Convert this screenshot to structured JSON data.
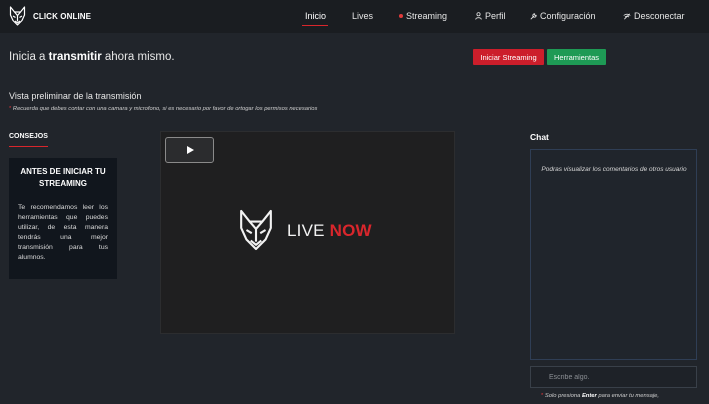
{
  "brand": {
    "name": "CLICK ONLINE",
    "logo_icon": "fox-icon"
  },
  "nav": {
    "items": [
      {
        "label": "Inicio",
        "active": true
      },
      {
        "label": "Lives",
        "active": false
      },
      {
        "label": "Streaming",
        "icon": "live-dot-icon",
        "active": false
      },
      {
        "label": "Perfil",
        "icon": "user-icon",
        "active": false
      },
      {
        "label": "Configuración",
        "icon": "wrench-icon",
        "active": false
      },
      {
        "label": "Desconectar",
        "icon": "signal-icon",
        "active": false
      }
    ]
  },
  "header": {
    "intro": "Inicia a ",
    "emphasis": "transmitir",
    "suffix": " ahora mismo.",
    "start_button": "Iniciar Streaming",
    "tools_button": "Herramientas"
  },
  "preview": {
    "title": "Vista preliminar de la transmisión",
    "note_mark": "*",
    "note": " Recuerda que debes contar con una camara y microfono, si es necesario por favor de ortogar los permisos necesarios"
  },
  "tips": {
    "heading": "CONSEJOS",
    "card_title": "ANTES DE INICIAR TU STREAMING",
    "card_body": "Te recomendamos leer los herramientas que puedes utilizar, de esta manera tendrás una mejor transmisión para tus alumnos."
  },
  "video": {
    "live_text": "LIVE",
    "now_text": "NOW",
    "play_icon": "play-icon"
  },
  "chat": {
    "heading": "Chat",
    "placeholder_message": "Podras visualizar los comentarios de otros usuario",
    "input_placeholder": "Escribe algo.",
    "hint_mark": "*",
    "hint_pre": " Solo presiona ",
    "hint_key": "Enter",
    "hint_post": " para enviar tu mensaje,"
  },
  "colors": {
    "background": "#21252b",
    "navbar": "#1a1d21",
    "accent_red": "#d9262c",
    "button_red": "#cc1e2b",
    "button_green": "#1e9a55",
    "card": "#11161d"
  }
}
